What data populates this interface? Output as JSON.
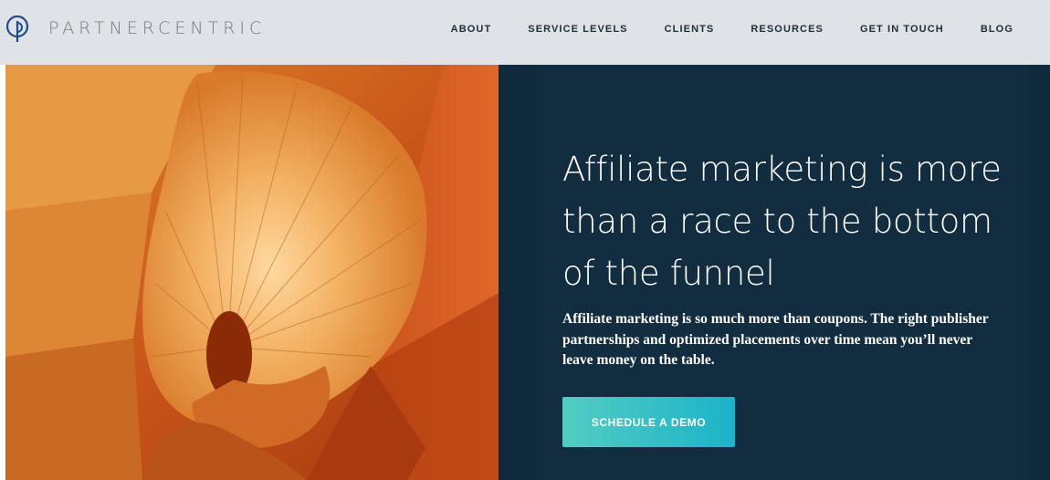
{
  "brand": {
    "name": "PARTNERCENTRIC",
    "logo_icon": "pc-logo-icon"
  },
  "nav": {
    "items": [
      {
        "label": "ABOUT"
      },
      {
        "label": "SERVICE LEVELS"
      },
      {
        "label": "CLIENTS"
      },
      {
        "label": "RESOURCES"
      },
      {
        "label": "GET IN TOUCH"
      },
      {
        "label": "BLOG"
      }
    ]
  },
  "hero": {
    "headline": "Affiliate marketing is more than a race to the bottom of the funnel",
    "body": "Affiliate marketing is so much more than coupons. The right publisher partnerships and optimized placements over time mean you’ll never leave money on the table.",
    "cta_label": "SCHEDULE A DEMO"
  },
  "colors": {
    "header_bg": "#dfe3e7",
    "panel_bg": "#122d3f",
    "cta_start": "#52cdc2",
    "cta_end": "#1bb3c9",
    "logo": "#1f4c8a"
  }
}
